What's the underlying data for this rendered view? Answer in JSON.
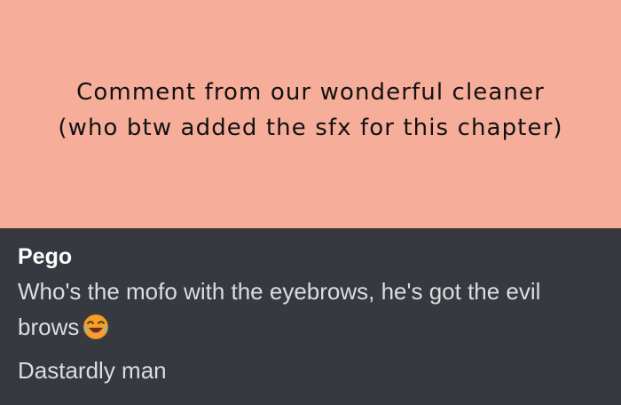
{
  "banner": {
    "line1": "Comment from our wonderful cleaner",
    "line2": "(who btw added the sfx for this chapter)",
    "background": "#f6ae9a"
  },
  "chat": {
    "background": "#36393f",
    "author": "Pego",
    "message_line1": "Who's the mofo with the eyebrows, he's got the evil",
    "message_line2": "brows",
    "emoji_icon": "laughing-crying-emoji",
    "message2": "Dastardly man"
  }
}
